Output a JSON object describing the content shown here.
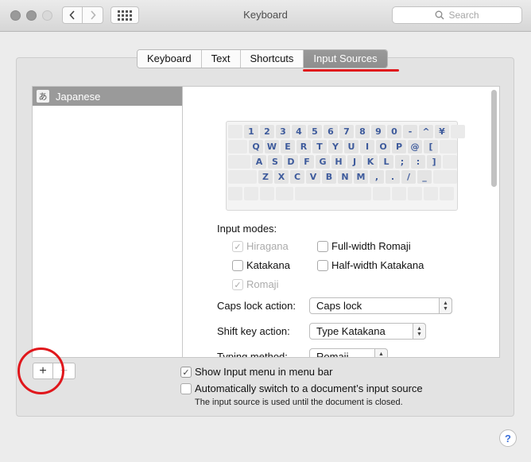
{
  "window": {
    "title": "Keyboard"
  },
  "search": {
    "placeholder": "Search"
  },
  "tabs": [
    {
      "label": "Keyboard"
    },
    {
      "label": "Text"
    },
    {
      "label": "Shortcuts"
    },
    {
      "label": "Input Sources",
      "active": true
    }
  ],
  "sources": [
    {
      "icon": "あ",
      "label": "Japanese",
      "selected": true
    }
  ],
  "keyboard": {
    "rows": [
      [
        "1",
        "2",
        "3",
        "4",
        "5",
        "6",
        "7",
        "8",
        "9",
        "0",
        "-",
        "^",
        "¥"
      ],
      [
        "Q",
        "W",
        "E",
        "R",
        "T",
        "Y",
        "U",
        "I",
        "O",
        "P",
        "@",
        "["
      ],
      [
        "A",
        "S",
        "D",
        "F",
        "G",
        "H",
        "J",
        "K",
        "L",
        ";",
        ":",
        "]"
      ],
      [
        "Z",
        "X",
        "C",
        "V",
        "B",
        "N",
        "M",
        ",",
        ".",
        "/",
        "_"
      ]
    ]
  },
  "input_modes": {
    "label": "Input modes:",
    "hiragana": {
      "label": "Hiragana",
      "checked": true,
      "disabled": true
    },
    "katakana": {
      "label": "Katakana",
      "checked": false
    },
    "romaji": {
      "label": "Romaji",
      "checked": true,
      "disabled": true
    },
    "fullwidth_romaji": {
      "label": "Full-width Romaji",
      "checked": false
    },
    "halfwidth_katakana": {
      "label": "Half-width Katakana",
      "checked": false
    }
  },
  "caps_lock": {
    "label": "Caps lock action:",
    "value": "Caps lock"
  },
  "shift_key": {
    "label": "Shift key action:",
    "value": "Type Katakana"
  },
  "typing_method": {
    "label": "Typing method:",
    "value": "Romaji"
  },
  "list_controls": {
    "add": "+",
    "remove": "−"
  },
  "options": {
    "show_menu": {
      "label": "Show Input menu in menu bar",
      "checked": true
    },
    "auto_switch": {
      "label": "Automatically switch to a document’s input source",
      "checked": false
    },
    "note": "The input source is used until the document is closed."
  },
  "help": {
    "label": "?"
  },
  "colors": {
    "accent_annotation": "#e0171c",
    "key_text": "#3e5b9c"
  }
}
